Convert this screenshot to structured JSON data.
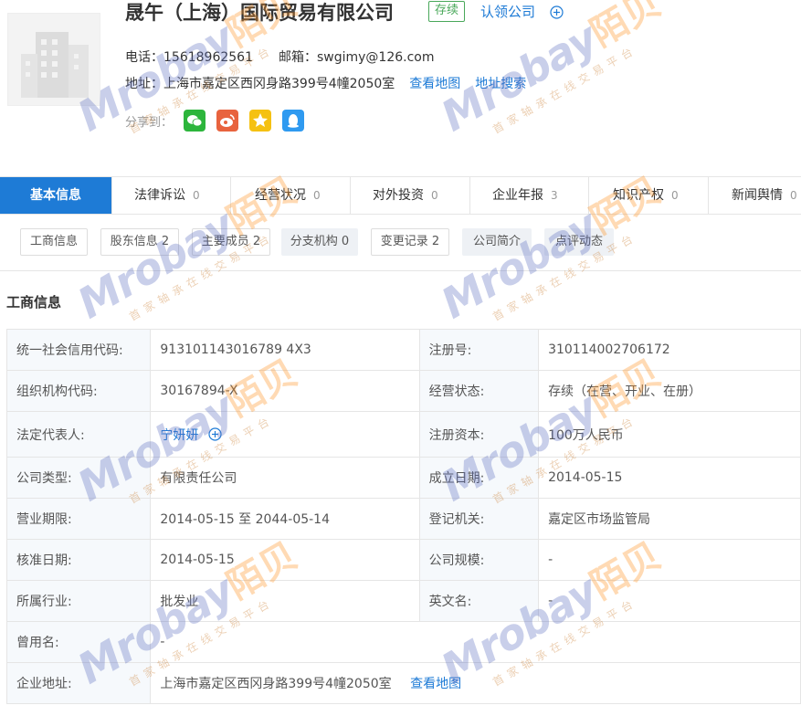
{
  "company": {
    "name": "晟午（上海）国际贸易有限公司",
    "status": "存续",
    "claim_label": "认领公司"
  },
  "contact": {
    "phone_label": "电话：",
    "phone": "15618962561",
    "email_label": "邮箱：",
    "email": "swgimy@126.com",
    "address_label": "地址：",
    "address": "上海市嘉定区西冈身路399号4幢2050室",
    "map_link": "查看地图",
    "search_link": "地址搜索",
    "share_label": "分享到："
  },
  "share_icons": [
    {
      "icon": "wechat-icon",
      "color": "#2db53c"
    },
    {
      "icon": "weibo-icon",
      "color": "#e8633e"
    },
    {
      "icon": "qzone-icon",
      "color": "#f5c112"
    },
    {
      "icon": "qq-icon",
      "color": "#2f9af0"
    }
  ],
  "tabs": [
    {
      "label": "基本信息",
      "count": ""
    },
    {
      "label": "法律诉讼",
      "count": "0"
    },
    {
      "label": "经营状况",
      "count": "0"
    },
    {
      "label": "对外投资",
      "count": "0"
    },
    {
      "label": "企业年报",
      "count": "3"
    },
    {
      "label": "知识产权",
      "count": "0"
    },
    {
      "label": "新闻舆情",
      "count": "0"
    }
  ],
  "subtabs": [
    {
      "label": "工商信息"
    },
    {
      "label": "股东信息 2"
    },
    {
      "label": "主要成员 2"
    },
    {
      "label": "分支机构 0"
    },
    {
      "label": "变更记录 2"
    },
    {
      "label": "公司简介"
    },
    {
      "label": "点评动态"
    }
  ],
  "section_title": "工商信息",
  "info": {
    "credit_code_label": "统一社会信用代码:",
    "credit_code": "913101143016789 4X3",
    "reg_no_label": "注册号:",
    "reg_no": "310114002706172",
    "org_code_label": "组织机构代码:",
    "org_code": "30167894-X",
    "biz_status_label": "经营状态:",
    "biz_status": "存续（在营、开业、在册）",
    "legal_rep_label": "法定代表人:",
    "legal_rep": "宁妍妍",
    "reg_capital_label": "注册资本:",
    "reg_capital": "100万人民币",
    "company_type_label": "公司类型:",
    "company_type": "有限责任公司",
    "founded_label": "成立日期:",
    "founded": "2014-05-15",
    "term_label": "营业期限:",
    "term": "2014-05-15 至 2044-05-14",
    "authority_label": "登记机关:",
    "authority": "嘉定区市场监管局",
    "approved_label": "核准日期:",
    "approved": "2014-05-15",
    "scale_label": "公司规模:",
    "scale": "-",
    "industry_label": "所属行业:",
    "industry": "批发业",
    "english_label": "英文名:",
    "english": "-",
    "former_label": "曾用名:",
    "former": "-",
    "address_label": "企业地址:",
    "address": "上海市嘉定区西冈身路399号4幢2050室",
    "map_link": "查看地图"
  },
  "watermark": {
    "brand": "Mrobay",
    "cn": "陌贝",
    "slogan": "首家轴承在线交易平台"
  }
}
